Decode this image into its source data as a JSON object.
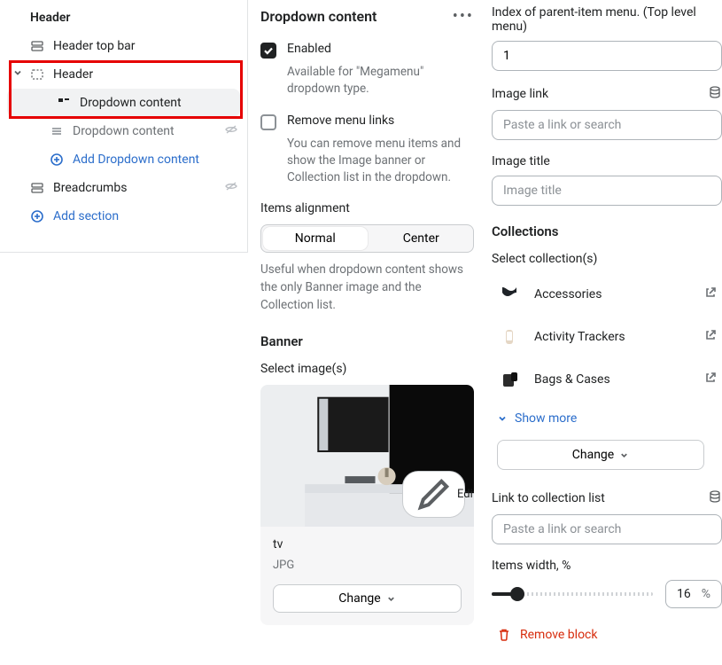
{
  "sidebar": {
    "group_title": "Header",
    "items": [
      {
        "label": "Header top bar"
      },
      {
        "label": "Header"
      },
      {
        "label": "Dropdown content"
      },
      {
        "label": "Dropdown content"
      },
      {
        "label": "Add Dropdown content"
      },
      {
        "label": "Breadcrumbs"
      },
      {
        "label": "Add section"
      }
    ]
  },
  "middle": {
    "title": "Dropdown content",
    "enabled_label": "Enabled",
    "enabled_desc": "Available for \"Megamenu\" dropdown type.",
    "remove_links_label": "Remove menu links",
    "remove_links_desc": "You can remove menu items and show the Image banner or Collection list in the dropdown.",
    "alignment_label": "Items alignment",
    "alignment_options": [
      "Normal",
      "Center"
    ],
    "alignment_help": "Useful when dropdown content shows the only Banner image and the Collection list.",
    "banner_heading": "Banner",
    "select_images_label": "Select image(s)",
    "edit_label": "Edit",
    "image_name": "tv",
    "image_format": "JPG",
    "change_label": "Change"
  },
  "right": {
    "index_label": "Index of parent-item menu. (Top level menu)",
    "index_value": "1",
    "image_link_label": "Image link",
    "image_link_placeholder": "Paste a link or search",
    "image_title_label": "Image title",
    "image_title_placeholder": "Image title",
    "collections_heading": "Collections",
    "select_collections_label": "Select collection(s)",
    "collections": [
      {
        "name": "Accessories"
      },
      {
        "name": "Activity Trackers"
      },
      {
        "name": "Bags & Cases"
      }
    ],
    "show_more_label": "Show more",
    "change_label": "Change",
    "link_collection_label": "Link to collection list",
    "link_collection_placeholder": "Paste a link or search",
    "items_width_label": "Items width, %",
    "items_width_value": "16",
    "items_width_unit": "%",
    "remove_block_label": "Remove block"
  }
}
